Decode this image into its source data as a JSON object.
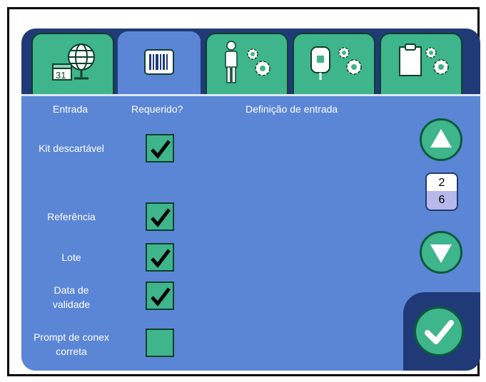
{
  "tabs": [
    {
      "name": "calendar-globe",
      "active": false
    },
    {
      "name": "barcode",
      "active": true
    },
    {
      "name": "person-gears",
      "active": false
    },
    {
      "name": "bag-gears",
      "active": false
    },
    {
      "name": "clipboard-gears",
      "active": false
    }
  ],
  "columns": {
    "entrada": "Entrada",
    "requerido": "Requerido?",
    "definicao": "Definição de entrada"
  },
  "rows": [
    {
      "label": "Kit descartável",
      "checked": true
    },
    {
      "label": "Referência",
      "checked": true
    },
    {
      "label": "Lote",
      "checked": true
    },
    {
      "label_line1": "Data de",
      "label_line2": "validade",
      "checked": true
    },
    {
      "label_line1": "Prompt de conex",
      "label_line2": "correta",
      "checked": false
    }
  ],
  "pagination": {
    "current": "2",
    "total": "6"
  },
  "colors": {
    "panel_bg": "#1f3a76",
    "content_bg": "#5b86d6",
    "accent_green": "#3eb58b",
    "lavender": "#b6b6ec"
  }
}
